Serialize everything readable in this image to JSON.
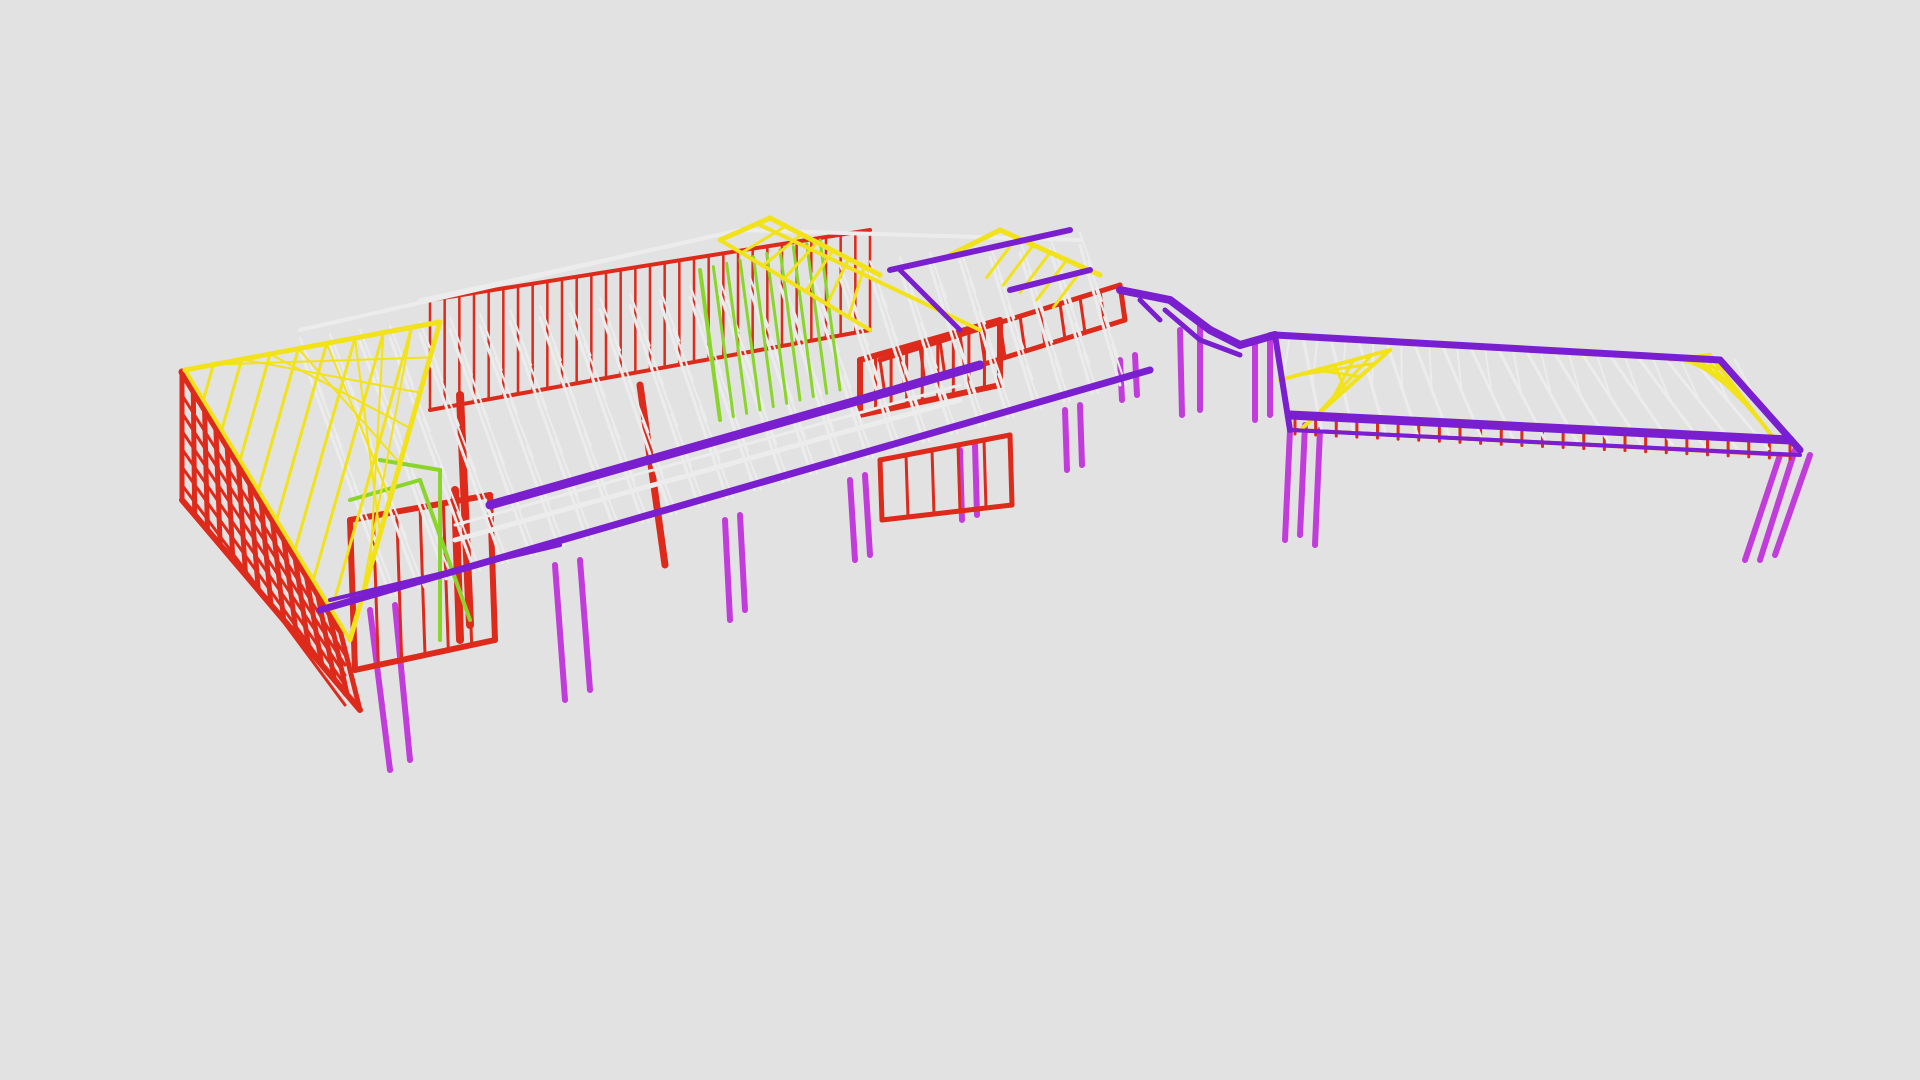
{
  "viewer": {
    "background_color": "#e2e2e2"
  },
  "model": {
    "colors": {
      "wall_frame": "#dd2a1b",
      "roof_truss": "#ececec",
      "hip_truss": "#f2e21a",
      "girder": "#7a1fd0",
      "post": "#c23cdc",
      "bracing": "#8ad52a"
    }
  }
}
